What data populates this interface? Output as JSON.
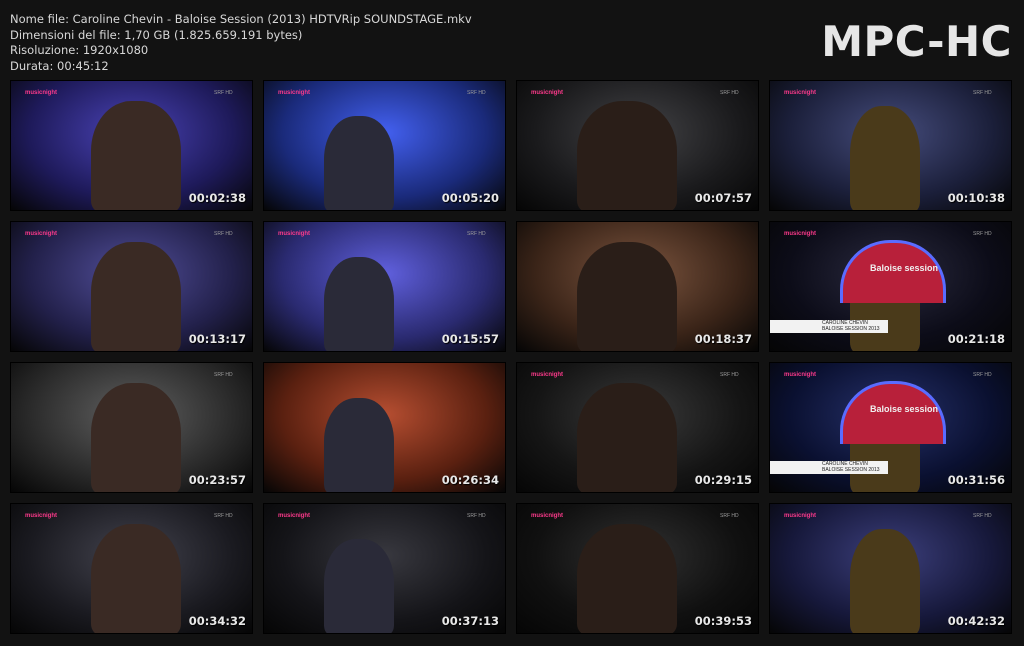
{
  "file_info": {
    "name_line": "Nome file: Caroline Chevin - Baloise Session (2013) HDTVRip SOUNDSTAGE.mkv",
    "size_line": "Dimensioni del file: 1,70 GB (1.825.659.191 bytes)",
    "resolution_line": "Risoluzione: 1920x1080",
    "duration_line": "Durata: 00:45:12"
  },
  "logo": "MPC-HC",
  "thumbnails": [
    {
      "time": "00:02:38",
      "brand": "musicnight",
      "channel": "SRF HD",
      "bg": "#1e1a5a"
    },
    {
      "time": "00:05:20",
      "brand": "musicnight",
      "channel": "SRF HD",
      "bg": "#1a2a7a"
    },
    {
      "time": "00:07:57",
      "brand": "musicnight",
      "channel": "SRF HD",
      "bg": "#1a1a1c"
    },
    {
      "time": "00:10:38",
      "brand": "musicnight",
      "channel": "SRF HD",
      "bg": "#1b1f3a"
    },
    {
      "time": "00:13:17",
      "brand": "musicnight",
      "channel": "SRF HD",
      "bg": "#22204a"
    },
    {
      "time": "00:15:57",
      "brand": "musicnight",
      "channel": "SRF HD",
      "bg": "#2a2a70"
    },
    {
      "time": "00:18:37",
      "brand": "",
      "channel": "",
      "bg": "#3a2418"
    },
    {
      "time": "00:21:18",
      "brand": "musicnight",
      "channel": "SRF HD",
      "bg": "#0c0c18",
      "stage": "Baloise session",
      "caption": [
        "CAROLINE CHEVIN",
        "BALOISE SESSION 2013"
      ]
    },
    {
      "time": "00:23:57",
      "brand": "",
      "channel": "SRF HD",
      "bg": "#2a2a2a"
    },
    {
      "time": "00:26:34",
      "brand": "",
      "channel": "",
      "bg": "#5a2010"
    },
    {
      "time": "00:29:15",
      "brand": "musicnight",
      "channel": "SRF HD",
      "bg": "#151515"
    },
    {
      "time": "00:31:56",
      "brand": "musicnight",
      "channel": "SRF HD",
      "bg": "#0a1030",
      "stage": "Baloise session",
      "caption": [
        "CAROLINE CHEVIN",
        "BALOISE SESSION 2013"
      ]
    },
    {
      "time": "00:34:32",
      "brand": "musicnight",
      "channel": "SRF HD",
      "bg": "#1a1a20"
    },
    {
      "time": "00:37:13",
      "brand": "musicnight",
      "channel": "SRF HD",
      "bg": "#141418"
    },
    {
      "time": "00:39:53",
      "brand": "musicnight",
      "channel": "SRF HD",
      "bg": "#101010"
    },
    {
      "time": "00:42:32",
      "brand": "musicnight",
      "channel": "SRF HD",
      "bg": "#16183a"
    }
  ]
}
